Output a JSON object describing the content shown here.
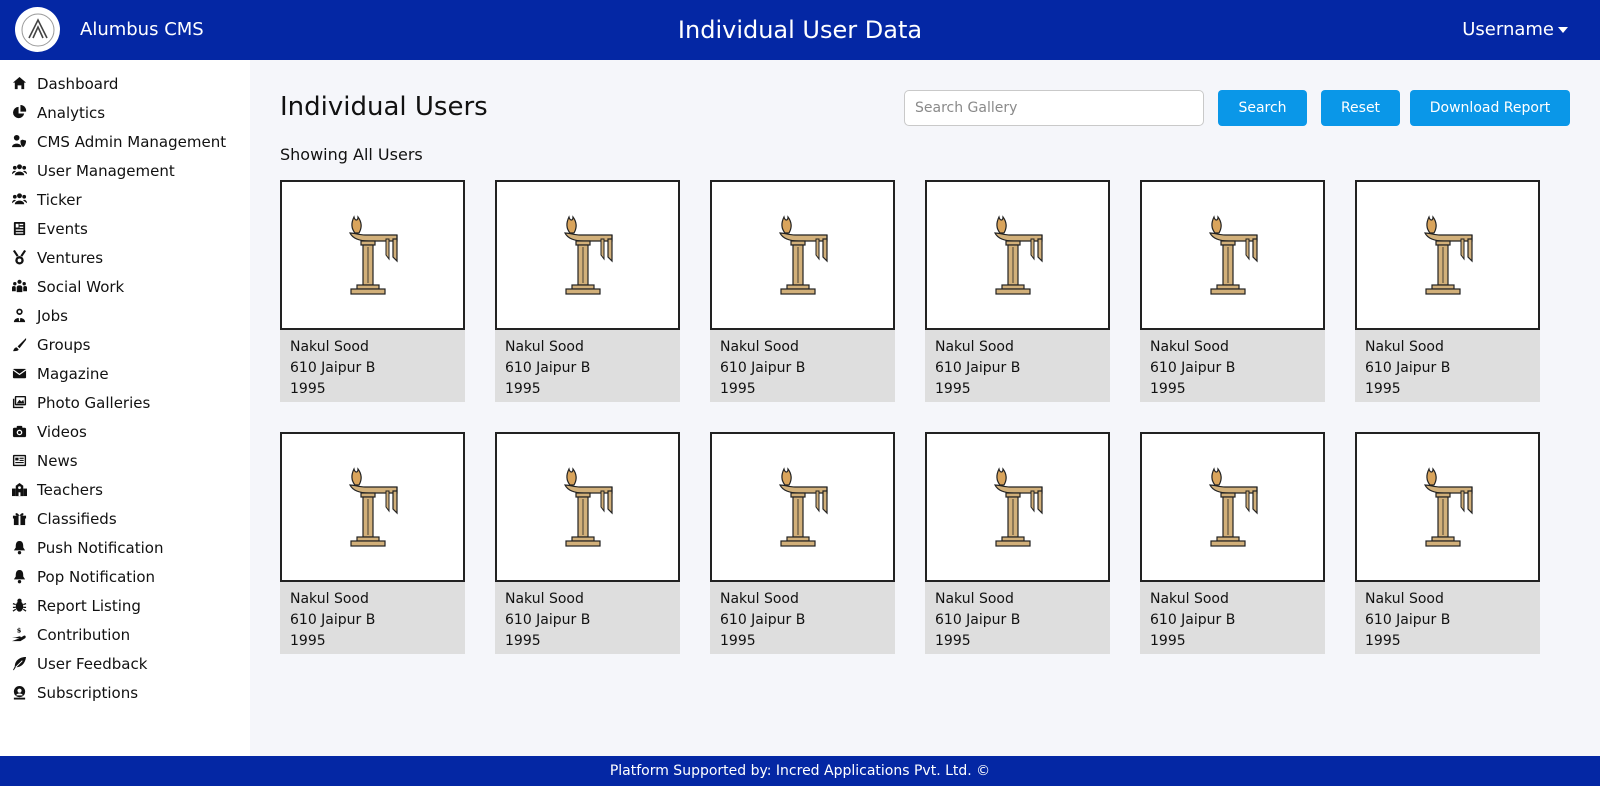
{
  "header": {
    "brand": "Alumbus CMS",
    "title": "Individual User Data",
    "user_menu": "Username"
  },
  "sidebar": {
    "items": [
      {
        "label": "Dashboard",
        "icon": "home-icon"
      },
      {
        "label": "Analytics",
        "icon": "pie-chart-icon"
      },
      {
        "label": "CMS Admin Management",
        "icon": "user-shield-icon"
      },
      {
        "label": "User Management",
        "icon": "users-icon"
      },
      {
        "label": "Ticker",
        "icon": "users-icon"
      },
      {
        "label": "Events",
        "icon": "newspaper-icon"
      },
      {
        "label": "Ventures",
        "icon": "medal-icon"
      },
      {
        "label": "Social Work",
        "icon": "people-group-icon"
      },
      {
        "label": "Jobs",
        "icon": "user-tie-icon"
      },
      {
        "label": "Groups",
        "icon": "brush-icon"
      },
      {
        "label": "Magazine",
        "icon": "envelope-icon"
      },
      {
        "label": "Photo Galleries",
        "icon": "images-icon"
      },
      {
        "label": "Videos",
        "icon": "camera-icon"
      },
      {
        "label": "News",
        "icon": "news-icon"
      },
      {
        "label": "Teachers",
        "icon": "school-icon"
      },
      {
        "label": "Classifieds",
        "icon": "gift-icon"
      },
      {
        "label": "Push Notification",
        "icon": "bell-icon"
      },
      {
        "label": "Pop Notification",
        "icon": "bell-icon"
      },
      {
        "label": "Report Listing",
        "icon": "bug-icon"
      },
      {
        "label": "Contribution",
        "icon": "hand-holding-dollar-icon"
      },
      {
        "label": "User Feedback",
        "icon": "feather-icon"
      },
      {
        "label": "Subscriptions",
        "icon": "subscription-icon"
      }
    ]
  },
  "main": {
    "title": "Individual Users",
    "search_placeholder": "Search Gallery",
    "search_button": "Search",
    "reset_button": "Reset",
    "download_button": "Download Report",
    "subtitle": "Showing All Users"
  },
  "users": [
    {
      "name": "Nakul Sood",
      "address": "610 Jaipur B",
      "year": "1995"
    },
    {
      "name": "Nakul Sood",
      "address": "610 Jaipur B",
      "year": "1995"
    },
    {
      "name": "Nakul Sood",
      "address": "610 Jaipur B",
      "year": "1995"
    },
    {
      "name": "Nakul Sood",
      "address": "610 Jaipur B",
      "year": "1995"
    },
    {
      "name": "Nakul Sood",
      "address": "610 Jaipur B",
      "year": "1995"
    },
    {
      "name": "Nakul Sood",
      "address": "610 Jaipur B",
      "year": "1995"
    },
    {
      "name": "Nakul Sood",
      "address": "610 Jaipur B",
      "year": "1995"
    },
    {
      "name": "Nakul Sood",
      "address": "610 Jaipur B",
      "year": "1995"
    },
    {
      "name": "Nakul Sood",
      "address": "610 Jaipur B",
      "year": "1995"
    },
    {
      "name": "Nakul Sood",
      "address": "610 Jaipur B",
      "year": "1995"
    },
    {
      "name": "Nakul Sood",
      "address": "610 Jaipur B",
      "year": "1995"
    },
    {
      "name": "Nakul Sood",
      "address": "610 Jaipur B",
      "year": "1995"
    }
  ],
  "footer": {
    "text": "Platform Supported by: Incred Applications Pvt. Ltd. ©"
  },
  "colors": {
    "header_bg": "#0427a4",
    "button_bg": "#0a97e8",
    "card_info_bg": "#dedede",
    "page_bg": "#f5f6fa"
  }
}
